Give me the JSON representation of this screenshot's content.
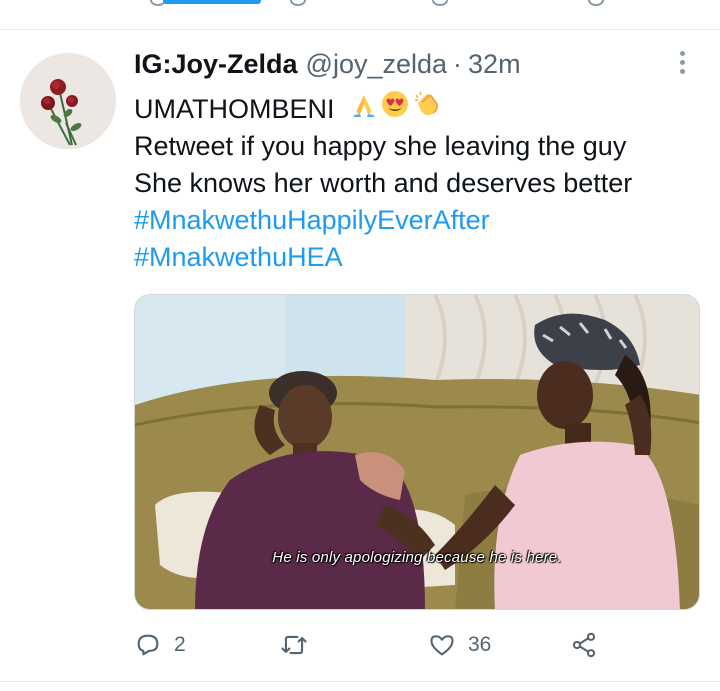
{
  "tweet": {
    "display_name": "IG:Joy-Zelda",
    "handle": "@joy_zelda",
    "separator": "·",
    "time": "32m",
    "lines": {
      "l1": "UMATHOMBENI",
      "l2": "Retweet if you happy she leaving the guy",
      "l3": "She knows her worth and deserves better"
    },
    "emojis": [
      "folded-hands",
      "heart-eyes",
      "clapping-hands"
    ],
    "hashtags": {
      "h1": "#MnakwethuHappilyEverAfter",
      "h2": "#MnakwethuHEA"
    },
    "media": {
      "subtitle": "He is only apologizing because he is here."
    },
    "actions": {
      "reply_count": "2",
      "retweet_count": "",
      "like_count": "36"
    }
  },
  "colors": {
    "accent": "#1d9bf0",
    "text": "#0f1419",
    "muted": "#536471"
  }
}
